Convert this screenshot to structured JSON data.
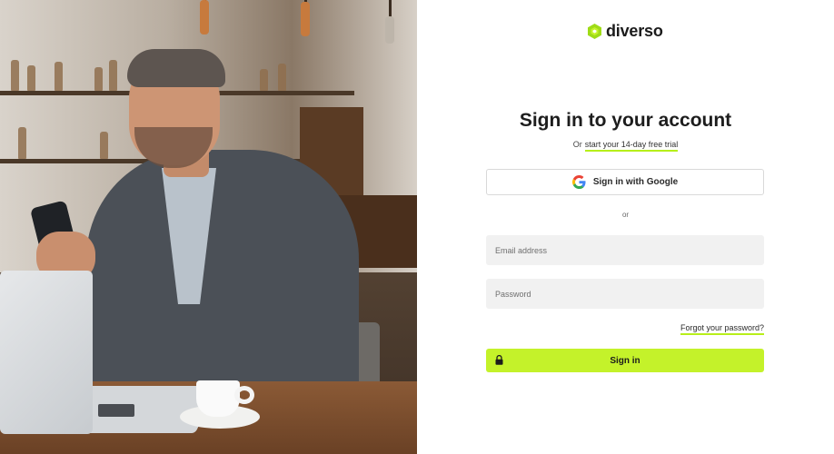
{
  "brand": {
    "name": "diverso",
    "accent_color": "#c4f22a",
    "mark_color": "#9fdc17"
  },
  "login": {
    "title": "Sign in to your account",
    "subtitle_prefix": "Or",
    "trial_link": "start your 14-day free trial",
    "google_button": "Sign in with Google",
    "divider": "or",
    "email_placeholder": "Email address",
    "password_placeholder": "Password",
    "forgot_password": "Forgot your password?",
    "submit_button": "Sign in"
  },
  "icons": {
    "google": "google-g-logo",
    "lock": "lock-icon",
    "brand_mark": "hexagon-logo"
  }
}
